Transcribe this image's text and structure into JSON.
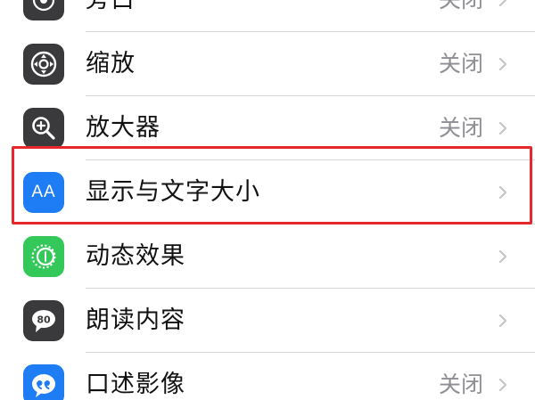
{
  "rows": [
    {
      "label": "旁白",
      "value": "关闭",
      "icon": "voiceover-icon",
      "icon_color": "#3a3a3c"
    },
    {
      "label": "缩放",
      "value": "关闭",
      "icon": "zoom-icon",
      "icon_color": "#3a3a3c"
    },
    {
      "label": "放大器",
      "value": "关闭",
      "icon": "magnifier-icon",
      "icon_color": "#3a3a3c"
    },
    {
      "label": "显示与文字大小",
      "value": "",
      "icon": "display-text-size-icon",
      "icon_text": "AA",
      "icon_color": "#1e7cf4"
    },
    {
      "label": "动态效果",
      "value": "",
      "icon": "motion-icon",
      "icon_color": "#34c759"
    },
    {
      "label": "朗读内容",
      "value": "",
      "icon": "spoken-content-icon",
      "icon_color": "#3a3a3c"
    },
    {
      "label": "口述影像",
      "value": "关闭",
      "icon": "audio-descriptions-icon",
      "icon_color": "#1e7cf4"
    }
  ],
  "highlight_color": "#e8272d"
}
